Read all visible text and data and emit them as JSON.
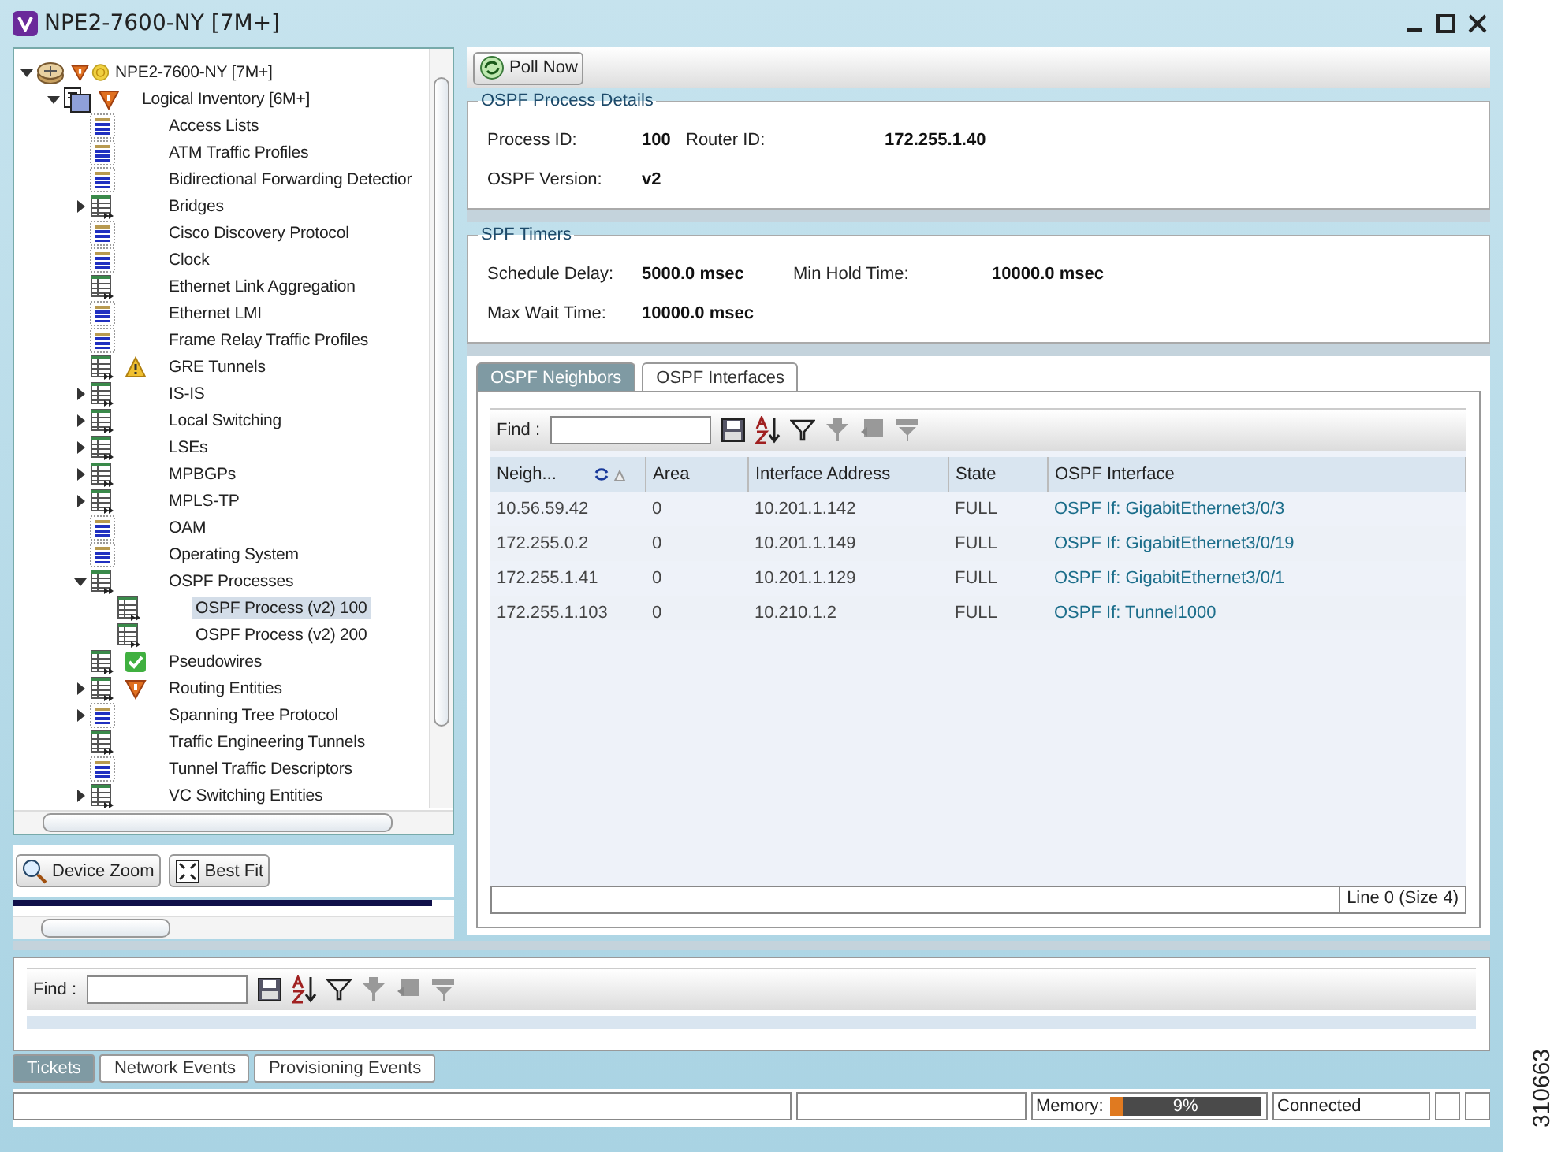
{
  "window": {
    "title": "NPE2-7600-NY [7M+]"
  },
  "tree": [
    {
      "label": "NPE2-7600-NY [7M+]",
      "kind": "device",
      "alarm": true,
      "polling": true,
      "expanded": true,
      "selected": false,
      "children": [
        {
          "label": "Logical Inventory [6M+]",
          "kind": "inventory",
          "alarm": true,
          "expanded": true,
          "selected": false,
          "children": [
            {
              "label": "Access Lists",
              "kind": "list",
              "selected": false
            },
            {
              "label": "ATM Traffic Profiles",
              "kind": "list",
              "selected": false
            },
            {
              "label": "Bidirectional Forwarding Detectior",
              "kind": "list",
              "selected": false
            },
            {
              "label": "Bridges",
              "kind": "table",
              "expanded": false,
              "selected": false
            },
            {
              "label": "Cisco Discovery Protocol",
              "kind": "list",
              "selected": false
            },
            {
              "label": "Clock",
              "kind": "list",
              "selected": false
            },
            {
              "label": "Ethernet Link Aggregation",
              "kind": "table",
              "selected": false
            },
            {
              "label": "Ethernet LMI",
              "kind": "list",
              "selected": false
            },
            {
              "label": "Frame Relay Traffic Profiles",
              "kind": "list",
              "selected": false
            },
            {
              "label": "GRE Tunnels",
              "kind": "table",
              "warning": true,
              "selected": false
            },
            {
              "label": "IS-IS",
              "kind": "table",
              "expanded": false,
              "selected": false
            },
            {
              "label": "Local Switching",
              "kind": "table",
              "expanded": false,
              "selected": false
            },
            {
              "label": "LSEs",
              "kind": "table",
              "expanded": false,
              "selected": false
            },
            {
              "label": "MPBGPs",
              "kind": "table",
              "expanded": false,
              "selected": false
            },
            {
              "label": "MPLS-TP",
              "kind": "table",
              "expanded": false,
              "selected": false
            },
            {
              "label": "OAM",
              "kind": "list",
              "selected": false
            },
            {
              "label": "Operating System",
              "kind": "list",
              "selected": false
            },
            {
              "label": "OSPF Processes",
              "kind": "table",
              "expanded": true,
              "selected": false,
              "children": [
                {
                  "label": "OSPF Process (v2) 100",
                  "kind": "table",
                  "selected": true
                },
                {
                  "label": "OSPF Process (v2) 200",
                  "kind": "table",
                  "selected": false
                }
              ]
            },
            {
              "label": "Pseudowires",
              "kind": "table",
              "ok": true,
              "selected": false
            },
            {
              "label": "Routing Entities",
              "kind": "table",
              "alarm": true,
              "expanded": false,
              "selected": false
            },
            {
              "label": "Spanning Tree Protocol",
              "kind": "list",
              "expanded": false,
              "selected": false
            },
            {
              "label": "Traffic Engineering Tunnels",
              "kind": "table",
              "selected": false
            },
            {
              "label": "Tunnel Traffic Descriptors",
              "kind": "list",
              "selected": false
            },
            {
              "label": "VC Switching Entities",
              "kind": "table",
              "expanded": false,
              "selected": false
            }
          ]
        }
      ]
    }
  ],
  "map_buttons": [
    "Device Zoom",
    "Best Fit"
  ],
  "poll_button": "Poll Now",
  "process_details": {
    "title": "OSPF Process Details",
    "rows": [
      [
        {
          "label": "Process ID:",
          "value": "100"
        },
        {
          "label": "Router ID:",
          "value": "172.255.1.40"
        }
      ],
      [
        {
          "label": "OSPF Version:",
          "value": "v2"
        }
      ]
    ]
  },
  "spf_timers": {
    "title": "SPF Timers",
    "rows": [
      [
        {
          "label": "Schedule Delay:",
          "value": "5000.0 msec"
        },
        {
          "label": "Min Hold Time:",
          "value": "10000.0 msec"
        }
      ],
      [
        {
          "label": "Max Wait Time:",
          "value": "10000.0 msec"
        }
      ]
    ]
  },
  "tabs": [
    {
      "label": "OSPF Neighbors",
      "selected": true
    },
    {
      "label": "OSPF Interfaces",
      "selected": false
    }
  ],
  "find_label": "Find :",
  "table": {
    "columns": [
      {
        "label": "Neigh...",
        "kind": "text",
        "sorted": true
      },
      {
        "label": "Area",
        "kind": "text",
        "sorted": false
      },
      {
        "label": "Interface Address",
        "kind": "text",
        "sorted": false
      },
      {
        "label": "State",
        "kind": "text",
        "sorted": false
      },
      {
        "label": "OSPF Interface",
        "kind": "link",
        "sorted": false
      }
    ],
    "rows": [
      [
        "10.56.59.42",
        "0",
        "10.201.1.142",
        "FULL",
        "OSPF If: GigabitEthernet3/0/3"
      ],
      [
        "172.255.0.2",
        "0",
        "10.201.1.149",
        "FULL",
        "OSPF If: GigabitEthernet3/0/19"
      ],
      [
        "172.255.1.41",
        "0",
        "10.201.1.129",
        "FULL",
        "OSPF If: GigabitEthernet3/0/1"
      ],
      [
        "172.255.1.103",
        "0",
        "10.210.1.2",
        "FULL",
        "OSPF If: Tunnel1000"
      ]
    ],
    "footer": "Line 0 (Size 4)"
  },
  "bottom": {
    "find_label": "Find :",
    "tabs": [
      {
        "label": "Tickets",
        "selected": true
      },
      {
        "label": "Network Events",
        "selected": false
      },
      {
        "label": "Provisioning Events",
        "selected": false
      }
    ]
  },
  "status_bar": {
    "memory": {
      "label": "Memory:",
      "level": 0.09,
      "reading": "9%"
    },
    "connection": "Connected"
  },
  "figure_number": "310663"
}
